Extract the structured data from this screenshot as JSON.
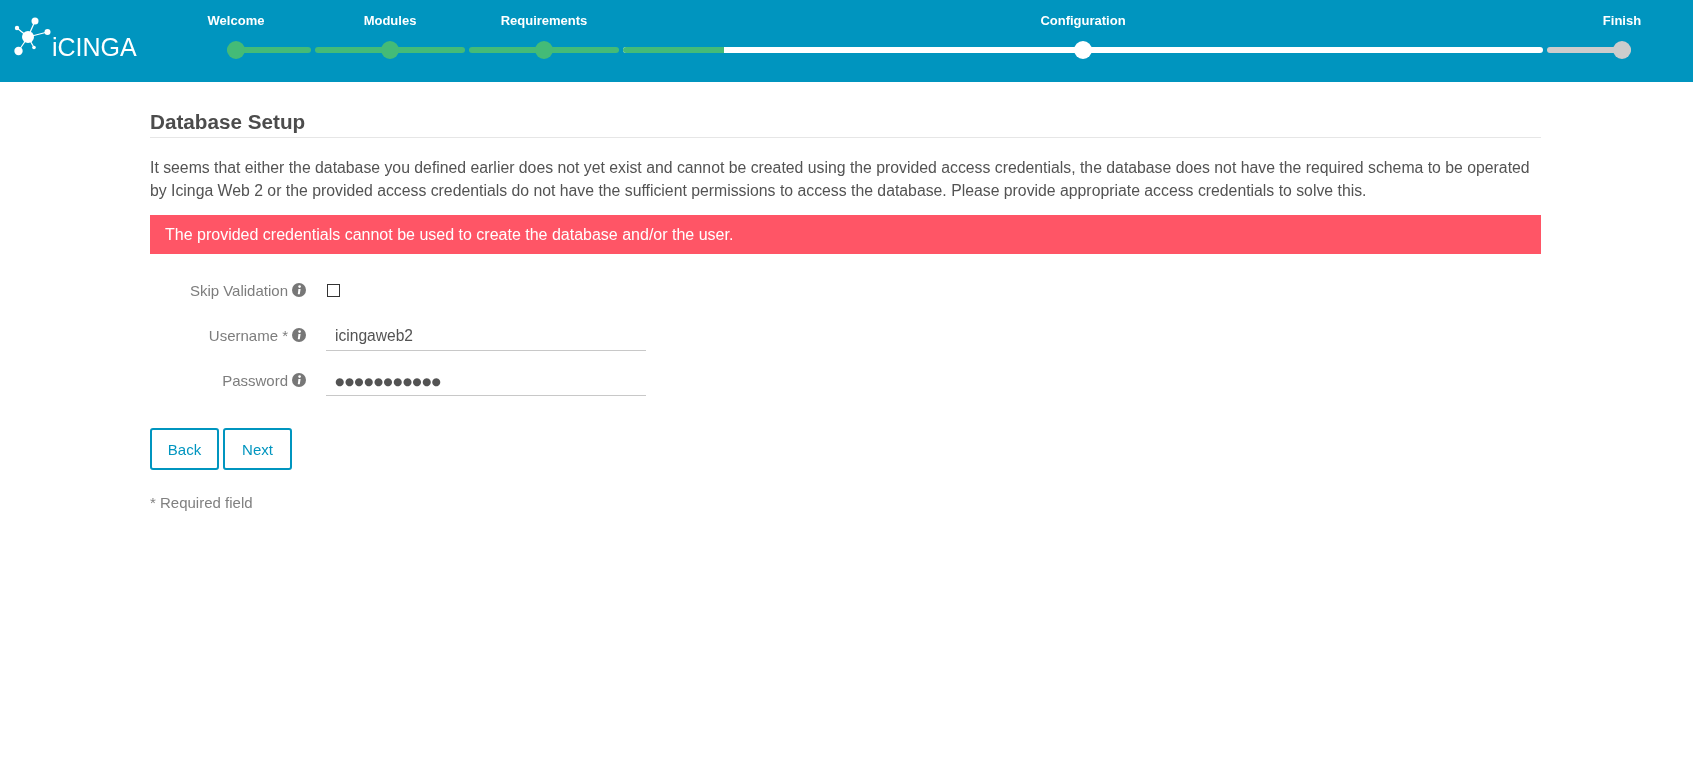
{
  "header": {
    "logo_text": "iCINGA"
  },
  "steps": [
    {
      "label": "Welcome",
      "completed": true,
      "active": false
    },
    {
      "label": "Modules",
      "completed": true,
      "active": false
    },
    {
      "label": "Requirements",
      "completed": true,
      "active": false
    },
    {
      "label": "Configuration",
      "completed": false,
      "active": true,
      "level": 0.11
    },
    {
      "label": "Finish",
      "completed": false,
      "active": false
    }
  ],
  "page": {
    "title": "Database Setup",
    "description": "It seems that either the database you defined earlier does not yet exist and cannot be created using the provided access credentials, the database does not have the required schema to be operated by Icinga Web 2 or the provided access credentials do not have the sufficient permissions to access the database. Please provide appropriate access credentials to solve this.",
    "error": "The provided credentials cannot be used to create the database and/or the user."
  },
  "form": {
    "fields": [
      {
        "kind": "checkbox",
        "label": "Skip Validation",
        "checked": false
      },
      {
        "kind": "text",
        "label": "Username *",
        "value": "icingaweb2"
      },
      {
        "kind": "password",
        "label": "Password",
        "value": "●●●●●●●●●●●"
      }
    ],
    "buttons": [
      "Back",
      "Next"
    ],
    "footnote": "* Required field"
  }
}
